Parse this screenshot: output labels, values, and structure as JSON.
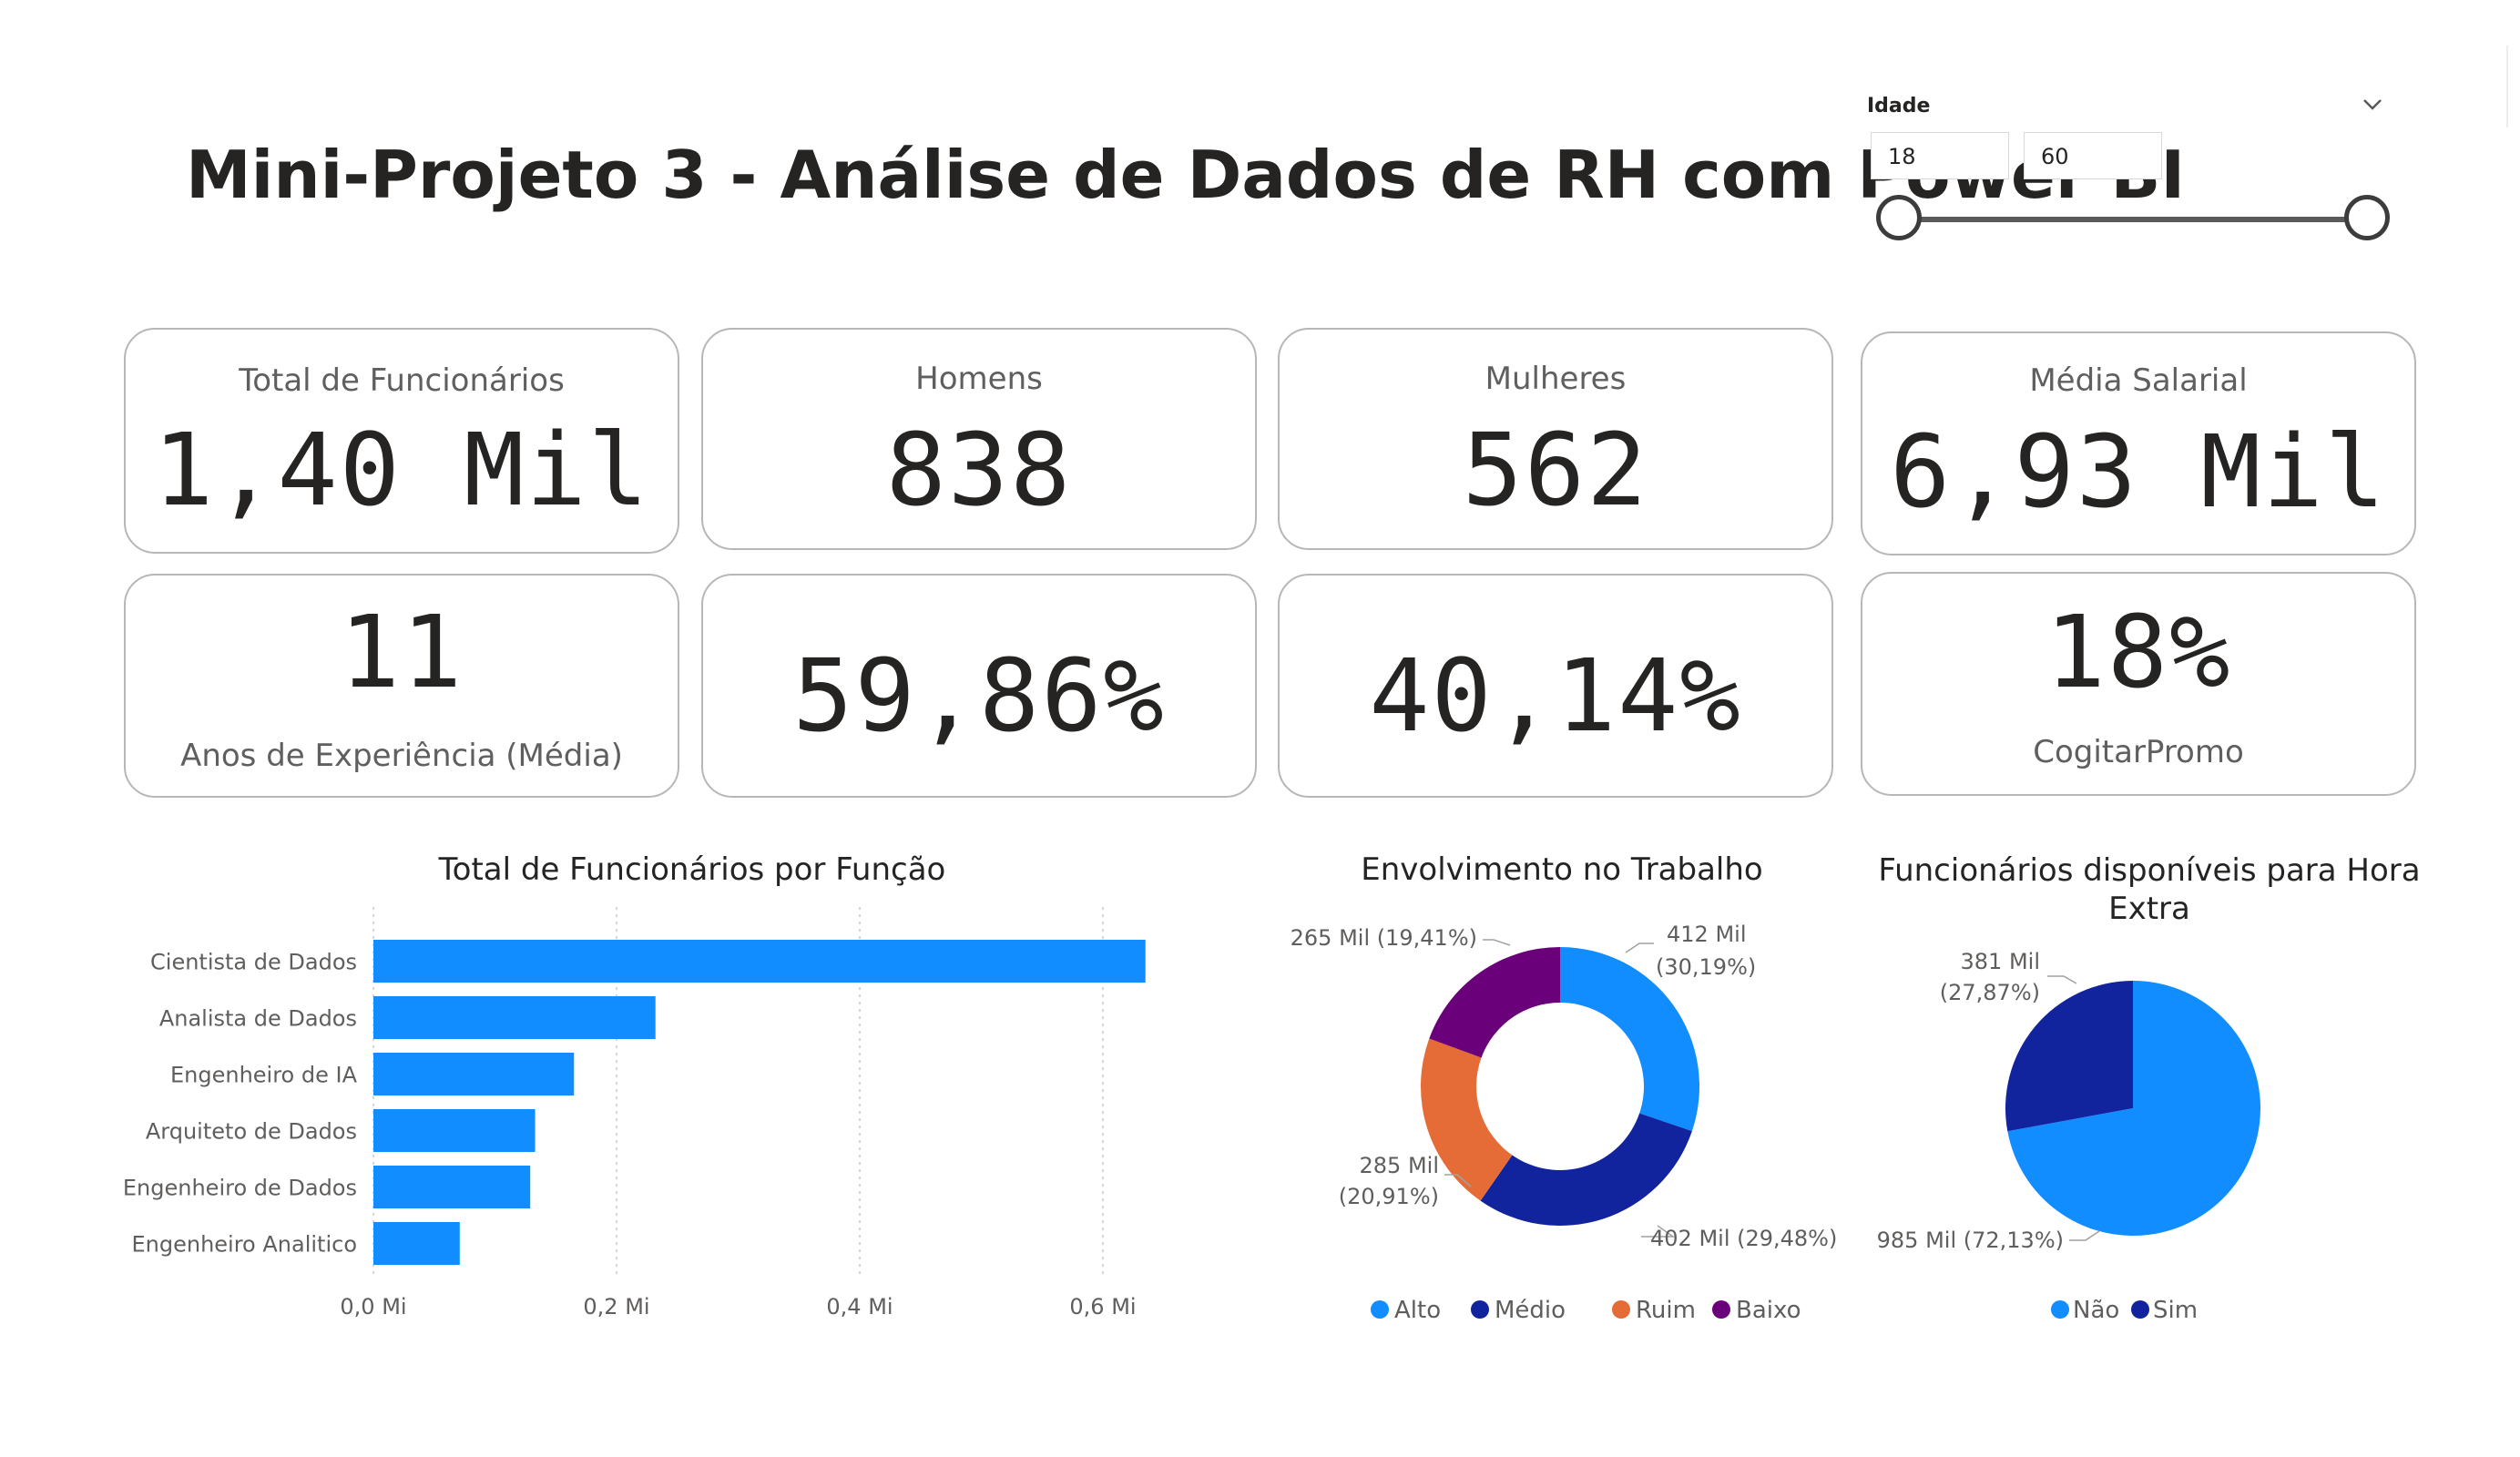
{
  "header": {
    "title": "Mini-Projeto 3 - Análise de Dados de RH com Power BI"
  },
  "slicer": {
    "label": "Idade",
    "min_value": "18",
    "max_value": "60",
    "range": [
      18,
      60
    ]
  },
  "cards": {
    "total": {
      "label": "Total de Funcionários",
      "value": "1,40 Mil"
    },
    "homens": {
      "label": "Homens",
      "value": "838"
    },
    "mulheres": {
      "label": "Mulheres",
      "value": "562"
    },
    "media_salarial": {
      "label": "Média Salarial",
      "value": "6,93 Mil"
    },
    "experiencia": {
      "label": "Anos de Experiência (Média)",
      "value": "11"
    },
    "pct_homens": {
      "value": "59,86%"
    },
    "pct_mulheres": {
      "value": "40,14%"
    },
    "cogitar_promo": {
      "label": "CogitarPromo",
      "value": "18%"
    }
  },
  "colors": {
    "bar": "#118DFF",
    "alto": "#118DFF",
    "medio": "#12239E",
    "ruim": "#E66C37",
    "baixo": "#6B007B",
    "nao": "#118DFF",
    "sim": "#12239E"
  },
  "chart_data": [
    {
      "type": "bar",
      "orientation": "horizontal",
      "title": "Total de Funcionários por Função",
      "categories": [
        "Cientista de Dados",
        "Analista de Dados",
        "Engenheiro de IA",
        "Arquiteto de Dados",
        "Engenheiro de Dados",
        "Engenheiro Analitico"
      ],
      "values": [
        0.635,
        0.232,
        0.165,
        0.133,
        0.129,
        0.071
      ],
      "xlim": [
        0,
        0.6
      ],
      "xticks": [
        0,
        0.2,
        0.4,
        0.6
      ],
      "xtick_labels": [
        "0,0 Mi",
        "0,2 Mi",
        "0,4 Mi",
        "0,6 Mi"
      ],
      "grid": true
    },
    {
      "type": "pie",
      "variant": "donut",
      "title": "Envolvimento no Trabalho",
      "series": [
        {
          "name": "Alto",
          "value": 412,
          "label": "412 Mil\n(30,19%)"
        },
        {
          "name": "Médio",
          "value": 402,
          "label": "402 Mil (29,48%)"
        },
        {
          "name": "Ruim",
          "value": 285,
          "label": "285 Mil\n(20,91%)"
        },
        {
          "name": "Baixo",
          "value": 265,
          "label": "265 Mil (19,41%)"
        }
      ],
      "legend": "bottom"
    },
    {
      "type": "pie",
      "title": "Funcionários disponíveis para Hora Extra",
      "series": [
        {
          "name": "Não",
          "value": 985,
          "label": "985 Mil (72,13%)"
        },
        {
          "name": "Sim",
          "value": 381,
          "label": "381 Mil\n(27,87%)"
        }
      ],
      "legend": "bottom"
    }
  ]
}
